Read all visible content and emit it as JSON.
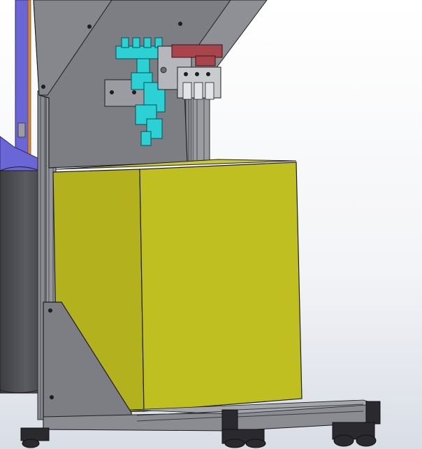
{
  "viewport": {
    "background_top": "#ffffff",
    "background_bottom": "#d9dde6"
  },
  "colors": {
    "panel": "#7c7e84",
    "panel_dark": "#55575c",
    "frame": "#8a8c92",
    "frame_dark": "#4a4b50",
    "box_front": "#c0bf22",
    "box_side": "#b3b21e",
    "box_top": "#c9c83a",
    "manifold": "#2bd1d4",
    "valve_red": "#a8454c",
    "bracket": "#9a9ca2",
    "purple_panel": "#6b66d6",
    "orange_edge": "#d8883c",
    "drum": "#4f5054",
    "wheel": "#2a2a2e"
  },
  "components": {
    "upper_panel": "gray-panel-icon",
    "yellow_box": "yellow-box-icon",
    "cyan_manifold": "manifold-icon",
    "valve_bank": "valve-bank-icon",
    "left_drum": "drum-icon",
    "base_frame": "base-frame-icon",
    "casters": "caster-icon",
    "side_gusset": "gusset-icon"
  }
}
